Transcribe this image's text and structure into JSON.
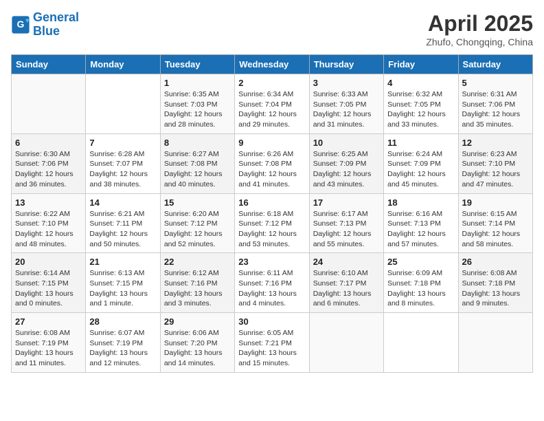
{
  "logo": {
    "text_general": "General",
    "text_blue": "Blue"
  },
  "title": "April 2025",
  "subtitle": "Zhufo, Chongqing, China",
  "days_of_week": [
    "Sunday",
    "Monday",
    "Tuesday",
    "Wednesday",
    "Thursday",
    "Friday",
    "Saturday"
  ],
  "weeks": [
    [
      {
        "day": "",
        "info": ""
      },
      {
        "day": "",
        "info": ""
      },
      {
        "day": "1",
        "info": "Sunrise: 6:35 AM\nSunset: 7:03 PM\nDaylight: 12 hours and 28 minutes."
      },
      {
        "day": "2",
        "info": "Sunrise: 6:34 AM\nSunset: 7:04 PM\nDaylight: 12 hours and 29 minutes."
      },
      {
        "day": "3",
        "info": "Sunrise: 6:33 AM\nSunset: 7:05 PM\nDaylight: 12 hours and 31 minutes."
      },
      {
        "day": "4",
        "info": "Sunrise: 6:32 AM\nSunset: 7:05 PM\nDaylight: 12 hours and 33 minutes."
      },
      {
        "day": "5",
        "info": "Sunrise: 6:31 AM\nSunset: 7:06 PM\nDaylight: 12 hours and 35 minutes."
      }
    ],
    [
      {
        "day": "6",
        "info": "Sunrise: 6:30 AM\nSunset: 7:06 PM\nDaylight: 12 hours and 36 minutes."
      },
      {
        "day": "7",
        "info": "Sunrise: 6:28 AM\nSunset: 7:07 PM\nDaylight: 12 hours and 38 minutes."
      },
      {
        "day": "8",
        "info": "Sunrise: 6:27 AM\nSunset: 7:08 PM\nDaylight: 12 hours and 40 minutes."
      },
      {
        "day": "9",
        "info": "Sunrise: 6:26 AM\nSunset: 7:08 PM\nDaylight: 12 hours and 41 minutes."
      },
      {
        "day": "10",
        "info": "Sunrise: 6:25 AM\nSunset: 7:09 PM\nDaylight: 12 hours and 43 minutes."
      },
      {
        "day": "11",
        "info": "Sunrise: 6:24 AM\nSunset: 7:09 PM\nDaylight: 12 hours and 45 minutes."
      },
      {
        "day": "12",
        "info": "Sunrise: 6:23 AM\nSunset: 7:10 PM\nDaylight: 12 hours and 47 minutes."
      }
    ],
    [
      {
        "day": "13",
        "info": "Sunrise: 6:22 AM\nSunset: 7:10 PM\nDaylight: 12 hours and 48 minutes."
      },
      {
        "day": "14",
        "info": "Sunrise: 6:21 AM\nSunset: 7:11 PM\nDaylight: 12 hours and 50 minutes."
      },
      {
        "day": "15",
        "info": "Sunrise: 6:20 AM\nSunset: 7:12 PM\nDaylight: 12 hours and 52 minutes."
      },
      {
        "day": "16",
        "info": "Sunrise: 6:18 AM\nSunset: 7:12 PM\nDaylight: 12 hours and 53 minutes."
      },
      {
        "day": "17",
        "info": "Sunrise: 6:17 AM\nSunset: 7:13 PM\nDaylight: 12 hours and 55 minutes."
      },
      {
        "day": "18",
        "info": "Sunrise: 6:16 AM\nSunset: 7:13 PM\nDaylight: 12 hours and 57 minutes."
      },
      {
        "day": "19",
        "info": "Sunrise: 6:15 AM\nSunset: 7:14 PM\nDaylight: 12 hours and 58 minutes."
      }
    ],
    [
      {
        "day": "20",
        "info": "Sunrise: 6:14 AM\nSunset: 7:15 PM\nDaylight: 13 hours and 0 minutes."
      },
      {
        "day": "21",
        "info": "Sunrise: 6:13 AM\nSunset: 7:15 PM\nDaylight: 13 hours and 1 minute."
      },
      {
        "day": "22",
        "info": "Sunrise: 6:12 AM\nSunset: 7:16 PM\nDaylight: 13 hours and 3 minutes."
      },
      {
        "day": "23",
        "info": "Sunrise: 6:11 AM\nSunset: 7:16 PM\nDaylight: 13 hours and 4 minutes."
      },
      {
        "day": "24",
        "info": "Sunrise: 6:10 AM\nSunset: 7:17 PM\nDaylight: 13 hours and 6 minutes."
      },
      {
        "day": "25",
        "info": "Sunrise: 6:09 AM\nSunset: 7:18 PM\nDaylight: 13 hours and 8 minutes."
      },
      {
        "day": "26",
        "info": "Sunrise: 6:08 AM\nSunset: 7:18 PM\nDaylight: 13 hours and 9 minutes."
      }
    ],
    [
      {
        "day": "27",
        "info": "Sunrise: 6:08 AM\nSunset: 7:19 PM\nDaylight: 13 hours and 11 minutes."
      },
      {
        "day": "28",
        "info": "Sunrise: 6:07 AM\nSunset: 7:19 PM\nDaylight: 13 hours and 12 minutes."
      },
      {
        "day": "29",
        "info": "Sunrise: 6:06 AM\nSunset: 7:20 PM\nDaylight: 13 hours and 14 minutes."
      },
      {
        "day": "30",
        "info": "Sunrise: 6:05 AM\nSunset: 7:21 PM\nDaylight: 13 hours and 15 minutes."
      },
      {
        "day": "",
        "info": ""
      },
      {
        "day": "",
        "info": ""
      },
      {
        "day": "",
        "info": ""
      }
    ]
  ]
}
